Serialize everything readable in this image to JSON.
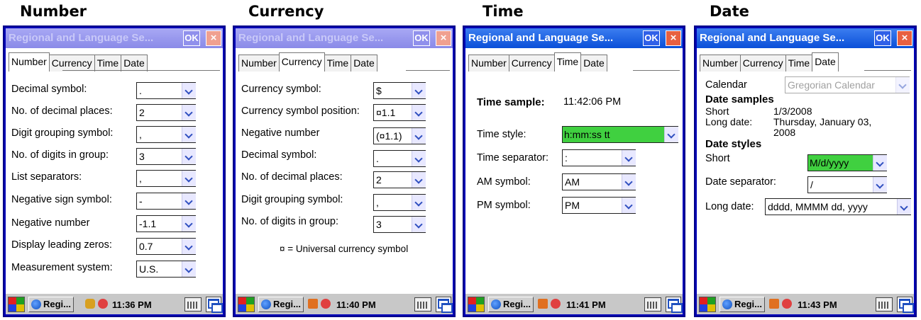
{
  "captions": {
    "number": "Number",
    "currency": "Currency",
    "time": "Time",
    "date": "Date"
  },
  "window_title": "Regional and Language Se...",
  "ok_label": "OK",
  "close_label": "×",
  "tabs": [
    "Number",
    "Currency",
    "Time",
    "Date"
  ],
  "number_panel": {
    "rows": [
      {
        "label": "Decimal symbol:",
        "value": "."
      },
      {
        "label": "No. of decimal places:",
        "value": "2"
      },
      {
        "label": "Digit grouping symbol:",
        "value": ","
      },
      {
        "label": "No. of digits in group:",
        "value": "3"
      },
      {
        "label": "List separators:",
        "value": ","
      },
      {
        "label": "Negative sign symbol:",
        "value": "-"
      },
      {
        "label": "Negative number",
        "value": "-1.1"
      },
      {
        "label": "Display leading zeros:",
        "value": "0.7"
      },
      {
        "label": "Measurement system:",
        "value": "U.S."
      }
    ],
    "taskbar": {
      "app": "Regi...",
      "time": "11:36 PM"
    }
  },
  "currency_panel": {
    "rows": [
      {
        "label": "Currency symbol:",
        "value": "$"
      },
      {
        "label": "Currency symbol position:",
        "value": "¤1.1"
      },
      {
        "label": "Negative number",
        "value": "(¤1.1)"
      },
      {
        "label": "Decimal symbol:",
        "value": "."
      },
      {
        "label": "No. of decimal places:",
        "value": "2"
      },
      {
        "label": "Digit grouping symbol:",
        "value": ","
      },
      {
        "label": "No. of digits in group:",
        "value": "3"
      }
    ],
    "note": "¤ = Universal currency symbol",
    "taskbar": {
      "app": "Regi...",
      "time": "11:40 PM"
    }
  },
  "time_panel": {
    "sample_label": "Time sample:",
    "sample_value": "11:42:06 PM",
    "rows": [
      {
        "label": "Time style:",
        "value": "h:mm:ss tt"
      },
      {
        "label": "Time separator:",
        "value": ":"
      },
      {
        "label": "AM symbol:",
        "value": "AM"
      },
      {
        "label": "PM symbol:",
        "value": "PM"
      }
    ],
    "taskbar": {
      "app": "Regi...",
      "time": "11:41 PM"
    }
  },
  "date_panel": {
    "calendar_label": "Calendar",
    "calendar_value": "Gregorian Calendar",
    "samples_heading": "Date samples",
    "short_label": "Short",
    "short_value": "1/3/2008",
    "long_label": "Long date:",
    "long_value_line1": "Thursday, January 03,",
    "long_value_line2": "2008",
    "styles_heading": "Date styles",
    "short_style_label": "Short",
    "short_style_value": "M/d/yyyy",
    "separator_label": "Date separator:",
    "separator_value": "/",
    "long_style_label": "Long date:",
    "long_style_value": "dddd, MMMM dd, yyyy",
    "taskbar": {
      "app": "Regi...",
      "time": "11:43 PM"
    }
  },
  "colors": {
    "title_active": "#0a4fd8",
    "highlight": "#40d040",
    "frame": "#0000b8"
  }
}
